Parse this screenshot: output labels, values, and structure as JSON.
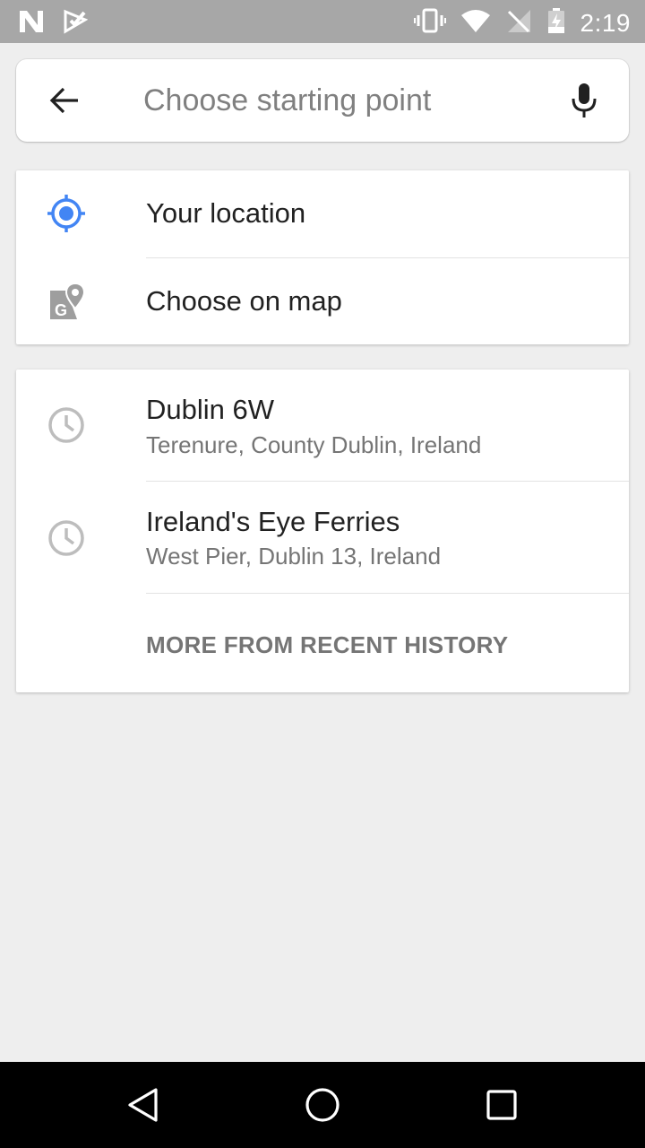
{
  "status_bar": {
    "time": "2:19",
    "left_icons": [
      "n-notification-icon",
      "checkmark-notification-icon"
    ],
    "right_icons": [
      "vibrate-icon",
      "wifi-icon",
      "no-signal-icon",
      "battery-charging-icon"
    ]
  },
  "search": {
    "placeholder": "Choose starting point",
    "value": ""
  },
  "options": [
    {
      "label": "Your location",
      "icon": "my-location-icon"
    },
    {
      "label": "Choose on map",
      "icon": "map-pin-icon"
    }
  ],
  "history": {
    "items": [
      {
        "title": "Dublin 6W",
        "subtitle": "Terenure, County Dublin, Ireland",
        "icon": "clock-icon"
      },
      {
        "title": "Ireland's Eye Ferries",
        "subtitle": "West Pier, Dublin 13, Ireland",
        "icon": "clock-icon"
      }
    ],
    "more_label": "MORE FROM RECENT HISTORY"
  },
  "colors": {
    "accent": "#4285f4",
    "status_bar": "#a7a7a7",
    "nav_bar": "#000000",
    "background": "#eeeeee",
    "icon_gray": "#9e9e9e"
  },
  "nav_bar": {
    "icons": [
      "back-triangle-icon",
      "home-circle-icon",
      "recents-square-icon"
    ]
  }
}
